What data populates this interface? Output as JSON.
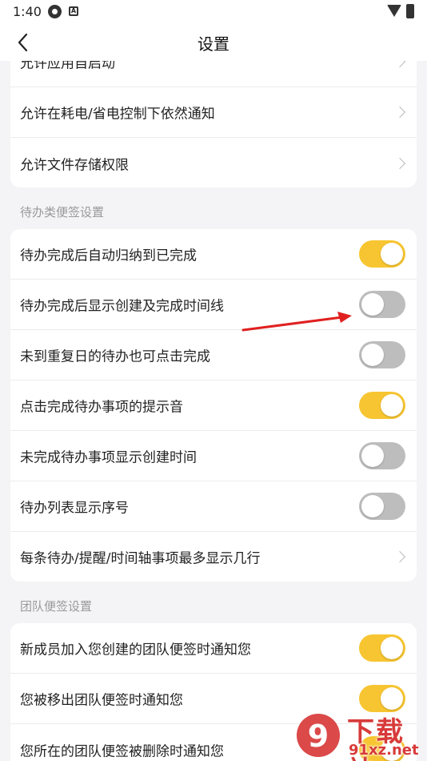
{
  "status_bar": {
    "time": "1:40",
    "icon_a_letter": "A"
  },
  "header": {
    "title": "设置"
  },
  "sections": {
    "top": {
      "items": [
        {
          "label": "允许应用自启动"
        },
        {
          "label": "允许在耗电/省电控制下依然通知"
        },
        {
          "label": "允许文件存储权限"
        }
      ]
    },
    "todo": {
      "title": "待办类便签设置",
      "items": [
        {
          "label": "待办完成后自动归纳到已完成",
          "state": "on"
        },
        {
          "label": "待办完成后显示创建及完成时间线",
          "state": "off"
        },
        {
          "label": "未到重复日的待办也可点击完成",
          "state": "off"
        },
        {
          "label": "点击完成待办事项的提示音",
          "state": "on"
        },
        {
          "label": "未完成待办事项显示创建时间",
          "state": "off"
        },
        {
          "label": "待办列表显示序号",
          "state": "off"
        },
        {
          "label": "每条待办/提醒/时间轴事项最多显示几行"
        }
      ]
    },
    "team": {
      "title": "团队便签设置",
      "items": [
        {
          "label": "新成员加入您创建的团队便签时通知您",
          "state": "on"
        },
        {
          "label": "您被移出团队便签时通知您",
          "state": "on"
        },
        {
          "label": "您所在的团队便签被删除时通知您",
          "state": "on"
        }
      ]
    }
  },
  "watermark": {
    "logo_digits": "9",
    "text": "下载站",
    "domain": "91xz.net"
  },
  "colors": {
    "toggle_on": "#f7c531",
    "toggle_off": "#bdbdbd",
    "annotation_arrow": "#e02020",
    "watermark": "#d83a3a"
  },
  "icons": [
    "back-arrow-icon",
    "chevron-right-icon",
    "wifi-icon",
    "battery-icon"
  ]
}
